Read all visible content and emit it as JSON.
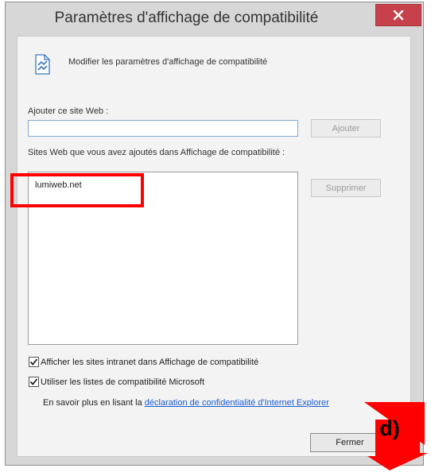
{
  "window": {
    "title": "Paramètres d'affichage de compatibilité",
    "close_glyph": "×"
  },
  "header": {
    "icon": "compatibility-view-icon",
    "text": "Modifier les paramètres d'affichage de compatibilité"
  },
  "add_site": {
    "label": "Ajouter ce site Web :",
    "value": "",
    "add_button": "Ajouter"
  },
  "sites": {
    "label": "Sites Web que vous avez ajoutés dans Affichage de compatibilité :",
    "items": [
      "lumiweb.net"
    ],
    "remove_button": "Supprimer"
  },
  "options": {
    "intranet": {
      "label": "Afficher les sites intranet dans Affichage de compatibilité",
      "checked": true
    },
    "ms_lists": {
      "label": "Utiliser les listes de compatibilité Microsoft",
      "checked": true
    }
  },
  "privacy": {
    "prefix": "En savoir plus en lisant la ",
    "link": "déclaration de confidentialité d'Internet Explorer"
  },
  "footer": {
    "close_button": "Fermer"
  },
  "annotation": {
    "label": "d)",
    "highlight_color": "#ff0000",
    "arrow_color": "#ff0000"
  }
}
